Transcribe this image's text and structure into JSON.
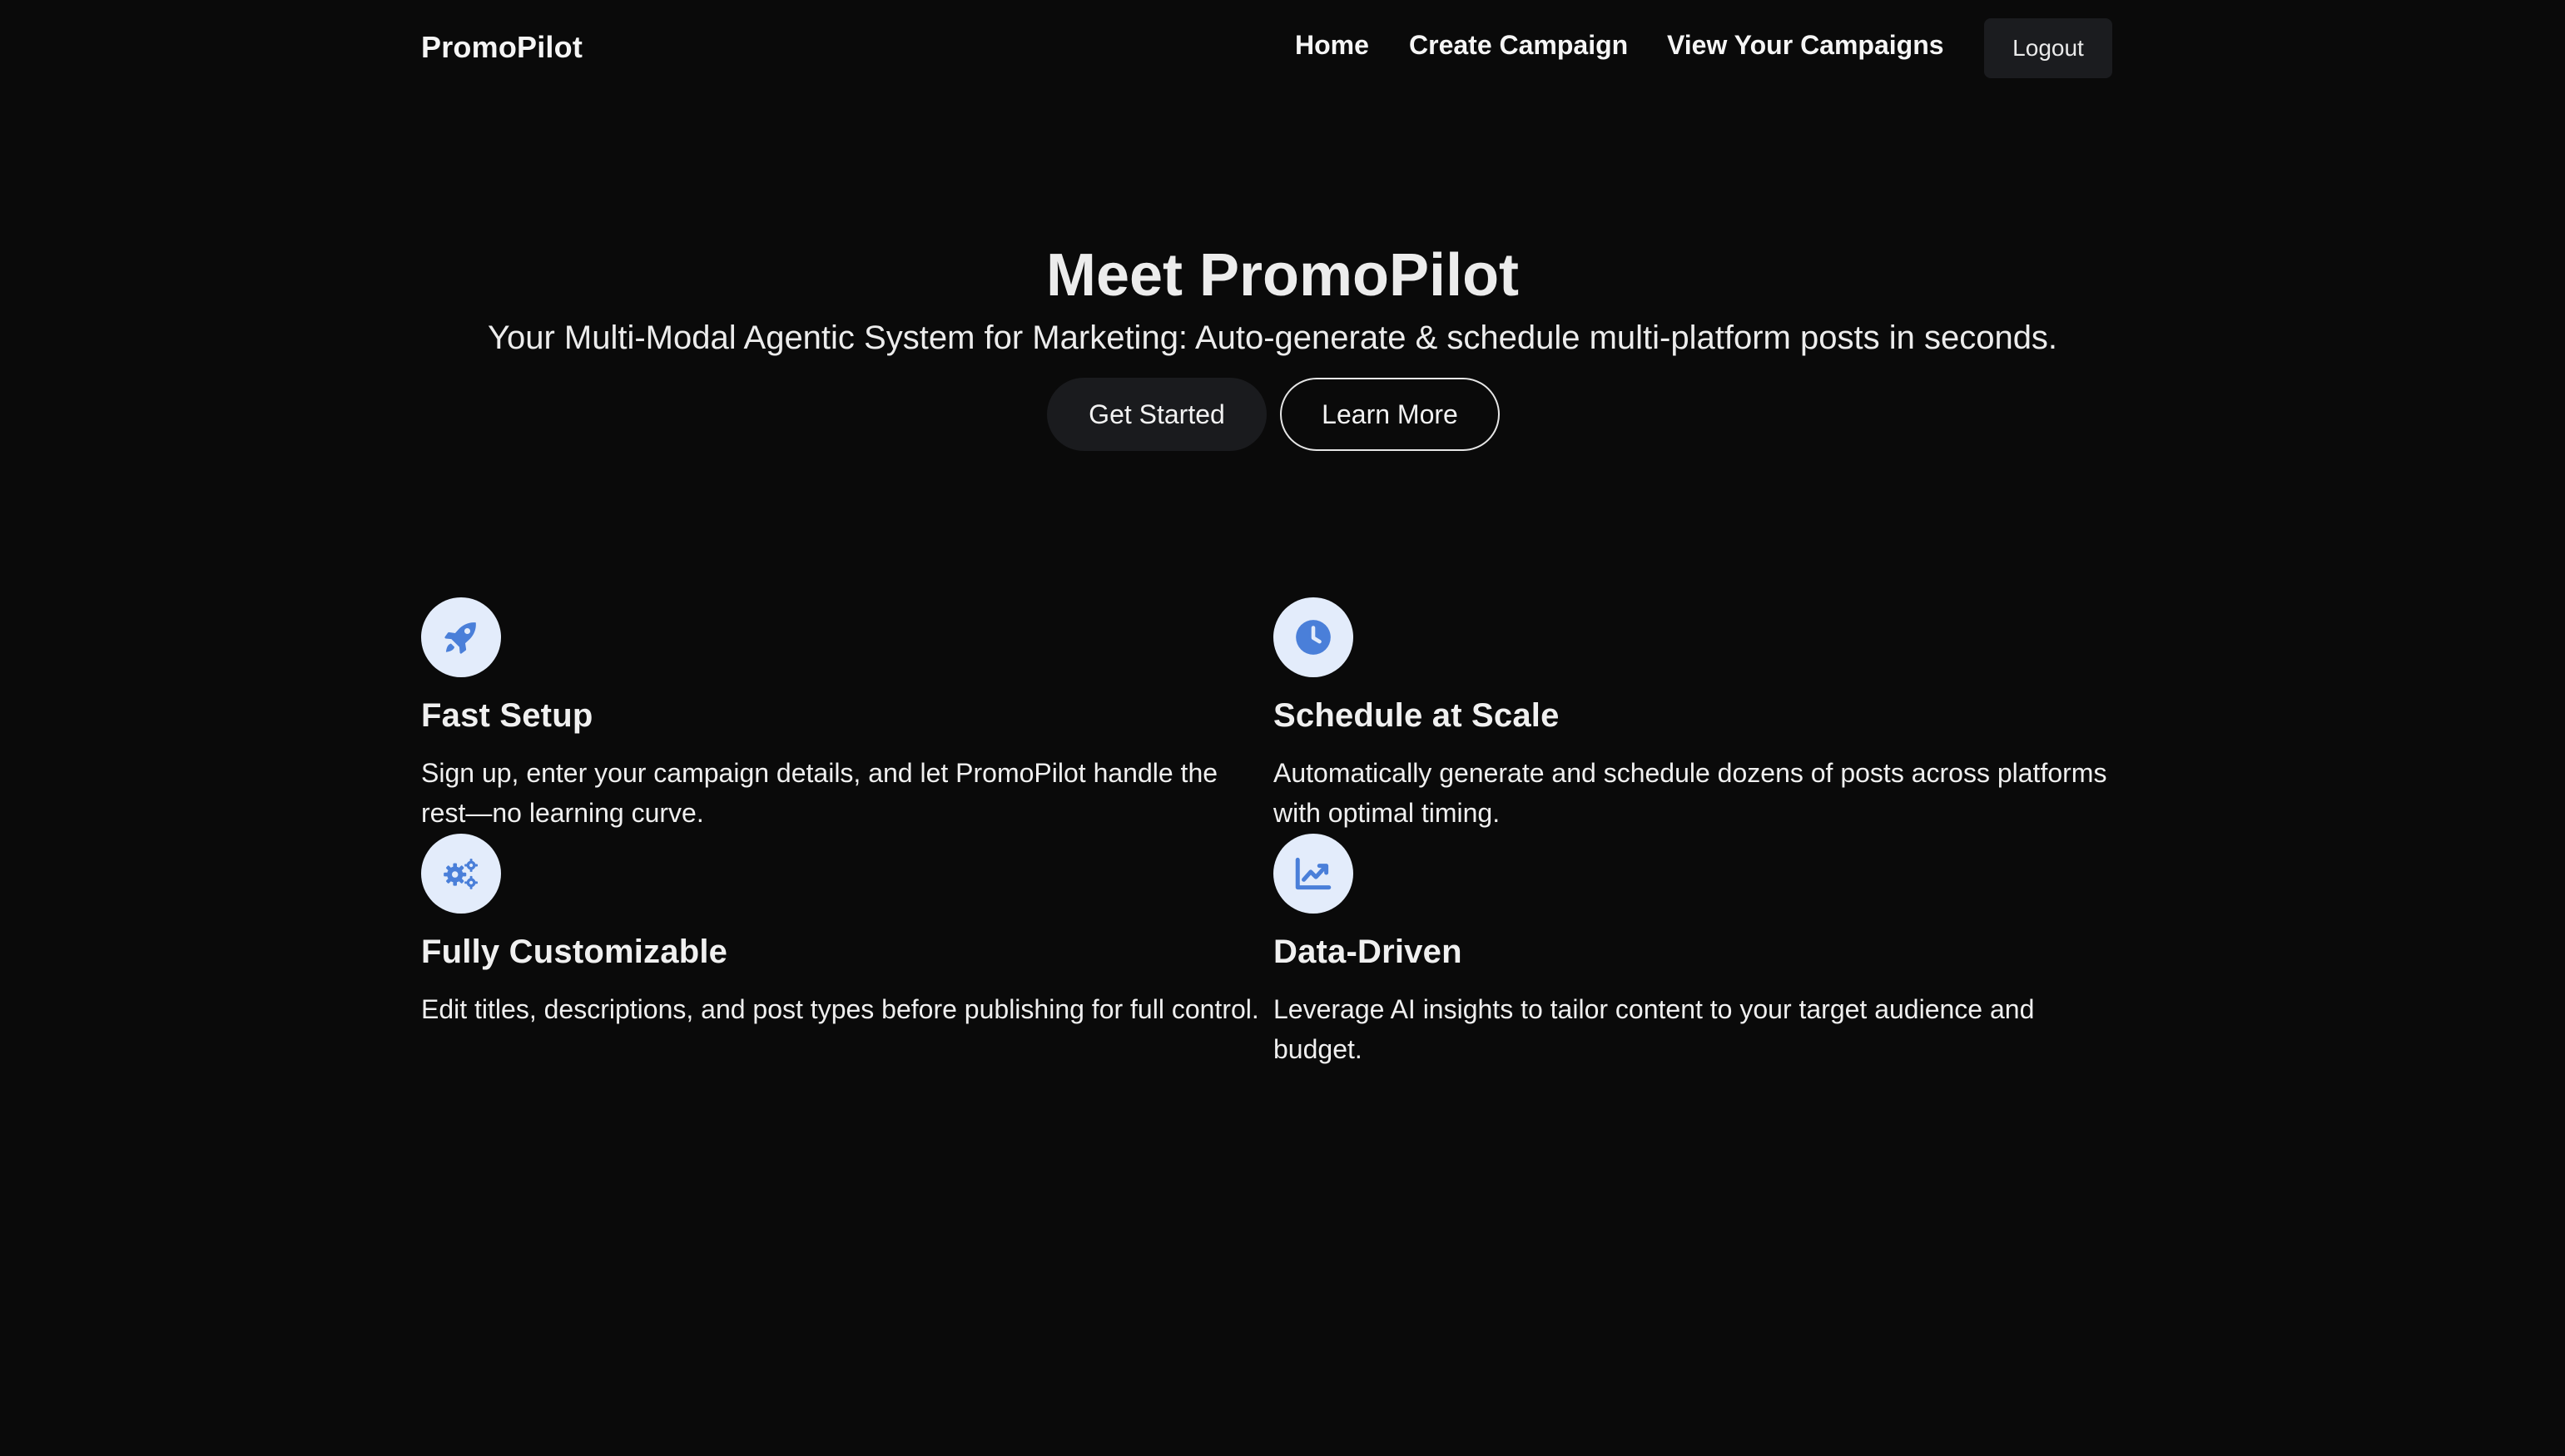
{
  "nav": {
    "brand": "PromoPilot",
    "links": [
      "Home",
      "Create Campaign",
      "View Your Campaigns"
    ],
    "logout": "Logout"
  },
  "hero": {
    "title": "Meet PromoPilot",
    "subtitle": "Your Multi-Modal Agentic System for Marketing: Auto-generate & schedule multi-platform posts in seconds.",
    "primary_button": "Get Started",
    "secondary_button": "Learn More"
  },
  "features": [
    {
      "icon": "rocket-icon",
      "title": "Fast Setup",
      "description": "Sign up, enter your campaign details, and let PromoPilot handle the rest—no learning curve."
    },
    {
      "icon": "clock-icon",
      "title": "Schedule at Scale",
      "description": "Automatically generate and schedule dozens of posts across platforms with optimal timing."
    },
    {
      "icon": "gears-icon",
      "title": "Fully Customizable",
      "description": "Edit titles, descriptions, and post types before publishing for full control."
    },
    {
      "icon": "chart-line-icon",
      "title": "Data-Driven",
      "description": "Leverage AI insights to tailor content to your target audience and budget."
    }
  ],
  "colors": {
    "background": "#0a0a0a",
    "icon_accent": "#4a7fd9",
    "icon_circle": "#e3ecfb",
    "button_dark": "#1a1b1e"
  }
}
